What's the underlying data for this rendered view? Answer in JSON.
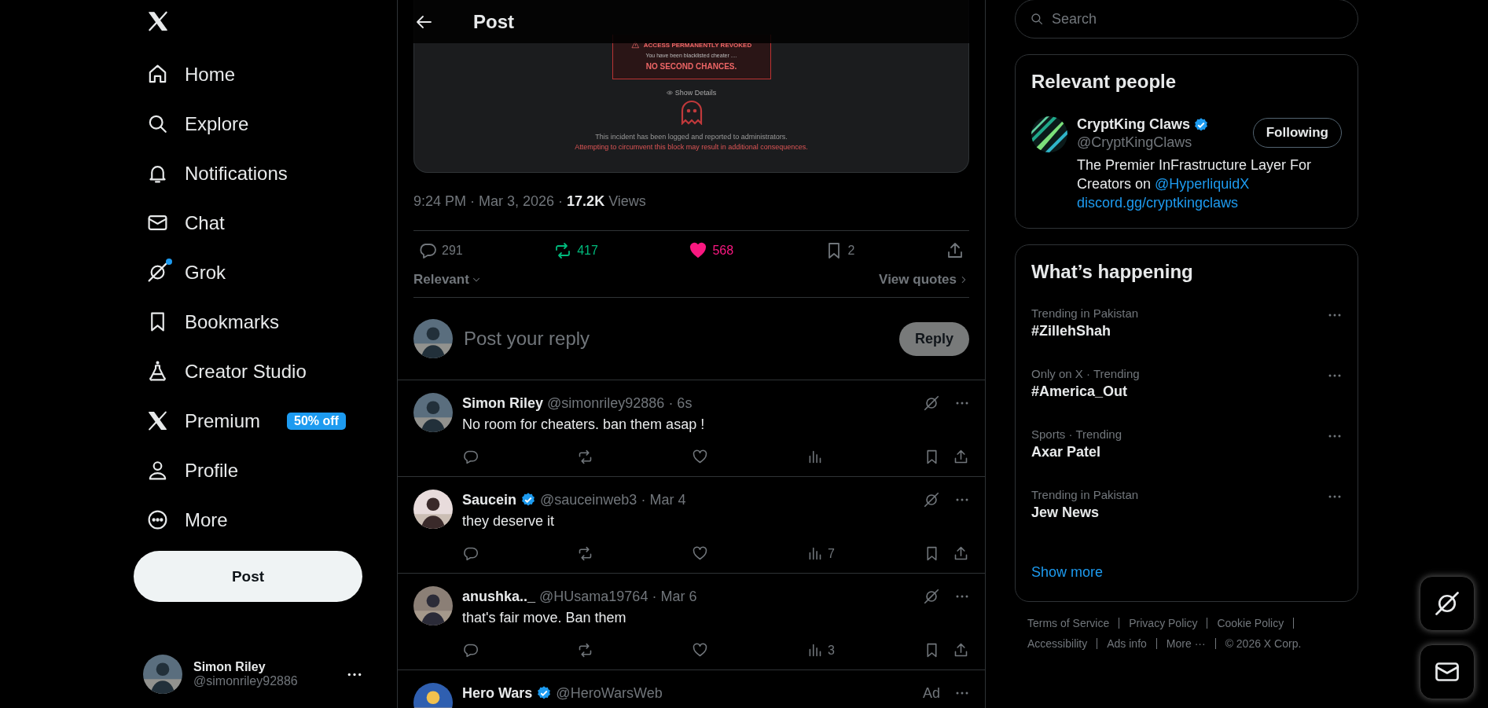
{
  "sidebar": {
    "nav": [
      {
        "label": "Home",
        "dot": false
      },
      {
        "label": "Explore",
        "dot": false
      },
      {
        "label": "Notifications",
        "dot": false
      },
      {
        "label": "Chat",
        "dot": false
      },
      {
        "label": "Grok",
        "dot": true
      },
      {
        "label": "Bookmarks",
        "dot": false
      },
      {
        "label": "Creator Studio",
        "dot": false
      },
      {
        "label": "Premium",
        "dot": false,
        "badge": "50% off"
      },
      {
        "label": "Profile",
        "dot": false
      },
      {
        "label": "More",
        "dot": false
      }
    ],
    "post_button": "Post",
    "account": {
      "name": "Simon Riley",
      "handle": "@simonriley92886"
    }
  },
  "header": {
    "title": "Post"
  },
  "embedded_screenshot": {
    "heading": "ACCESS PERMANENTLY REVOKED",
    "message": "You have been blacklisted cheater ....",
    "emphasis": "NO SECOND CHANCES.",
    "details_link": "Show Details",
    "notice": "This incident has been logged and reported to administrators.",
    "warning": "Attempting to circumvent this block may result in additional consequences."
  },
  "post_meta": {
    "time": "9:24 PM · Mar 3, 2026 · ",
    "views_count": "17.2K",
    "views_label": "Views"
  },
  "stats": {
    "replies": "291",
    "reposts": "417",
    "reposted": true,
    "likes": "568",
    "liked": true,
    "bookmarks": "2",
    "bookmarked": false
  },
  "sort": {
    "label": "Relevant",
    "view_quotes": "View quotes"
  },
  "composer": {
    "placeholder": "Post your reply",
    "button": "Reply",
    "disabled": true
  },
  "replies": [
    {
      "kind": "reply",
      "name": "Simon Riley",
      "verified": false,
      "handle": "@simonriley92886",
      "time": "· 6s",
      "text": "No room for cheaters. ban them asap !"
    },
    {
      "kind": "reply",
      "name": "Saucein",
      "verified": true,
      "handle": "@sauceinweb3",
      "time": "· Mar 4",
      "text": "they deserve it",
      "views": "7"
    },
    {
      "kind": "reply",
      "name": "anushka.._",
      "verified": false,
      "handle": "@HUsama19764",
      "time": "· Mar 6",
      "text": "that's fair move. Ban them",
      "views": "3"
    },
    {
      "kind": "ad",
      "name": "Hero Wars",
      "verified": true,
      "handle": "@HeroWarsWeb",
      "ad_label": "Ad"
    }
  ],
  "search": {
    "placeholder": "Search"
  },
  "relevant_people": {
    "title": "Relevant people",
    "person": {
      "name": "CryptKing Claws",
      "verified": true,
      "handle": "@CryptKingClaws",
      "bio": "The Premier InFrastructure Layer For Creators on ",
      "mention": "@HyperliquidX",
      "link": "discord.gg/cryptkingclaws",
      "button": "Following"
    }
  },
  "trends": {
    "title": "What’s happening",
    "items": [
      {
        "context": "Trending in Pakistan",
        "topic": "#ZillehShah"
      },
      {
        "context": "Only on X · Trending",
        "topic": "#America_Out"
      },
      {
        "context": "Sports · Trending",
        "topic": "Axar Patel"
      },
      {
        "context": "Trending in Pakistan",
        "topic": "Jew News"
      }
    ],
    "show_more": "Show more"
  },
  "footer": {
    "links": [
      "Terms of Service",
      "Privacy Policy",
      "Cookie Policy",
      "Accessibility",
      "Ads info",
      "More ···"
    ],
    "copyright": "© 2026 X Corp."
  }
}
